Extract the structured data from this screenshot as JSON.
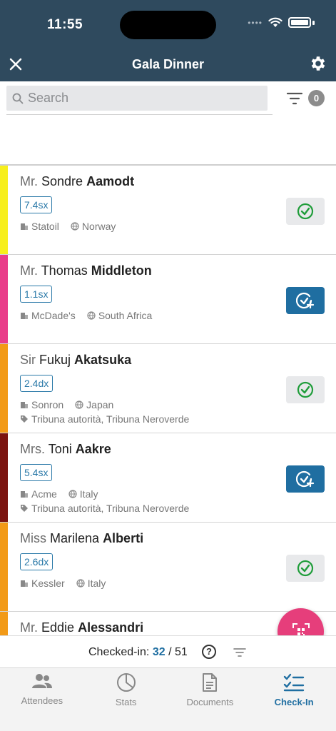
{
  "status": {
    "time": "11:55"
  },
  "header": {
    "title": "Gala Dinner"
  },
  "search": {
    "placeholder": "Search"
  },
  "filter": {
    "count": "0"
  },
  "attendees": [
    {
      "salutation": "Mr.",
      "first": "Sondre",
      "last": "Aamodt",
      "code": "7.4sx",
      "company": "Statoil",
      "country": "Norway",
      "tags": "",
      "color": "#f7ef1c",
      "checked": true
    },
    {
      "salutation": "Mr.",
      "first": "Thomas",
      "last": "Middleton",
      "code": "1.1sx",
      "company": "McDade's",
      "country": "South Africa",
      "tags": "",
      "color": "#e93d8a",
      "checked": false
    },
    {
      "salutation": "Sir",
      "first": "Fukuj",
      "last": "Akatsuka",
      "code": "2.4dx",
      "company": "Sonron",
      "country": "Japan",
      "tags": "Tribuna autorità, Tribuna Neroverde",
      "color": "#f29a17",
      "checked": true
    },
    {
      "salutation": "Mrs.",
      "first": "Toni",
      "last": "Aakre",
      "code": "5.4sx",
      "company": "Acme",
      "country": "Italy",
      "tags": "Tribuna autorità, Tribuna Neroverde",
      "color": "#7b1410",
      "checked": false
    },
    {
      "salutation": "Miss",
      "first": "Marilena",
      "last": "Alberti",
      "code": "2.6dx",
      "company": "Kessler",
      "country": "Italy",
      "tags": "",
      "color": "#f29a17",
      "checked": true
    },
    {
      "salutation": "Mr.",
      "first": "Eddie",
      "last": "Alessandri",
      "code": "",
      "company": "",
      "country": "",
      "tags": "",
      "color": "#f29a17",
      "checked": false
    }
  ],
  "checkin": {
    "label": "Checked-in:",
    "count": "32",
    "separator": "/",
    "total": "51"
  },
  "tabs": [
    {
      "label": "Attendees",
      "icon": "people-icon"
    },
    {
      "label": "Stats",
      "icon": "pie-chart-icon"
    },
    {
      "label": "Documents",
      "icon": "document-icon"
    },
    {
      "label": "Check-In",
      "icon": "checklist-icon"
    }
  ],
  "colors": {
    "header": "#2f4a5e",
    "accent": "#1f6ea1",
    "fab": "#e63e7b",
    "check_green": "#1f9d3a"
  }
}
